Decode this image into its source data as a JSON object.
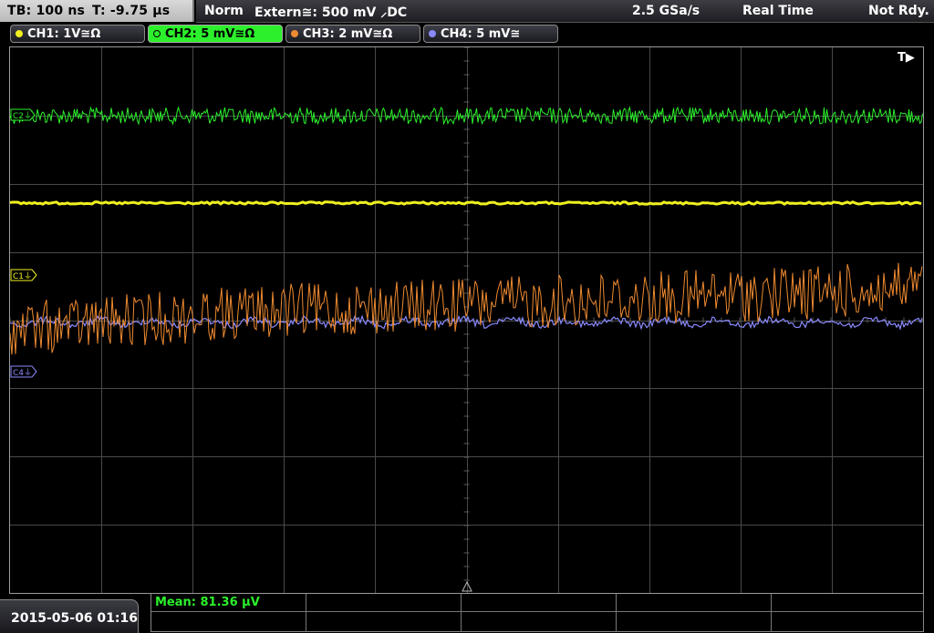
{
  "timebase": {
    "tb": "TB: 100 ns",
    "t": "T: -9.75 µs"
  },
  "trigger_info": {
    "mode": "Norm",
    "source": "Extern≅: 500 mV ⸝DC",
    "sample_rate": "2.5 GSa/s",
    "acq_mode": "Real Time",
    "status": "Not Rdy."
  },
  "channels": [
    {
      "label": "CH1: 1V≅Ω",
      "color": "#f0f020",
      "active": false
    },
    {
      "label": "CH2: 5 mV≅Ω",
      "color": "#2cf02c",
      "active": true
    },
    {
      "label": "CH3: 2 mV≅Ω",
      "color": "#ee8a30",
      "active": false
    },
    {
      "label": "CH4: 5 mV≅",
      "color": "#8a8aff",
      "active": false
    }
  ],
  "markers": {
    "c1": "C1⏚",
    "c2": "C2⏚",
    "c4": "C4⏚",
    "trigger": "T▶"
  },
  "measurement": {
    "mean": "Mean: 81.36 µV"
  },
  "datetime": "2015-05-06 01:16",
  "colors": {
    "grid": "#4a4a4a",
    "ch1": "#f0f020",
    "ch2": "#2cf02c",
    "ch3": "#ee8a30",
    "ch4": "#8a8aff"
  }
}
